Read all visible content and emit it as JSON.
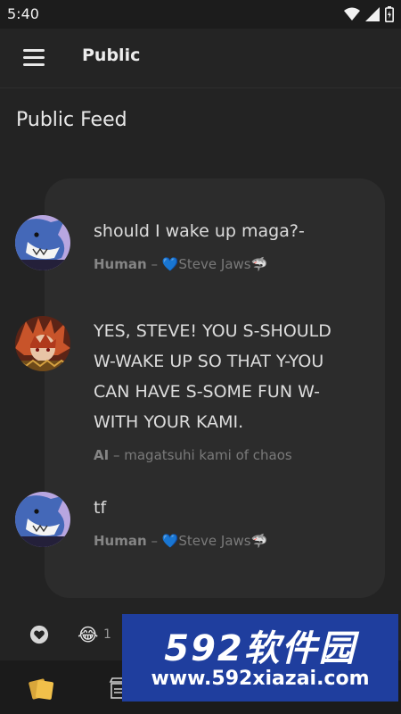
{
  "status_bar": {
    "time": "5:40"
  },
  "app_bar": {
    "title": "Public"
  },
  "feed": {
    "title": "Public Feed",
    "messages": [
      {
        "text": "should I wake up maga?-",
        "role": "Human",
        "separator": " – ",
        "author_emoji": "💙",
        "author": "Steve Jaws",
        "author_suffix": "🦈"
      },
      {
        "text": "YES, STEVE! YOU S-SHOULD W-WAKE UP SO THAT Y-YOU CAN HAVE S-SOME FUN W-WITH YOUR KAMI.",
        "role": "AI",
        "separator": " – ",
        "author": "magatsuhi kami of chaos"
      },
      {
        "text": "tf",
        "role": "Human",
        "separator": " – ",
        "author_emoji": "💙",
        "author": "Steve Jaws",
        "author_suffix": "🦈"
      }
    ]
  },
  "reactions": {
    "emoji": "😂",
    "count": "1"
  },
  "watermark": {
    "brand": "592软件园",
    "url": "www.592xiazai.com"
  },
  "colors": {
    "background": "#232323",
    "card": "#2c2c2c",
    "nav": "#1b1b1b",
    "accent_yellow": "#f1c04a",
    "watermark_blue": "#1f3e9e"
  },
  "icons": [
    "menu-icon",
    "wifi-icon",
    "cellular-icon",
    "battery-icon",
    "heart-icon",
    "cards-icon",
    "store-icon"
  ]
}
